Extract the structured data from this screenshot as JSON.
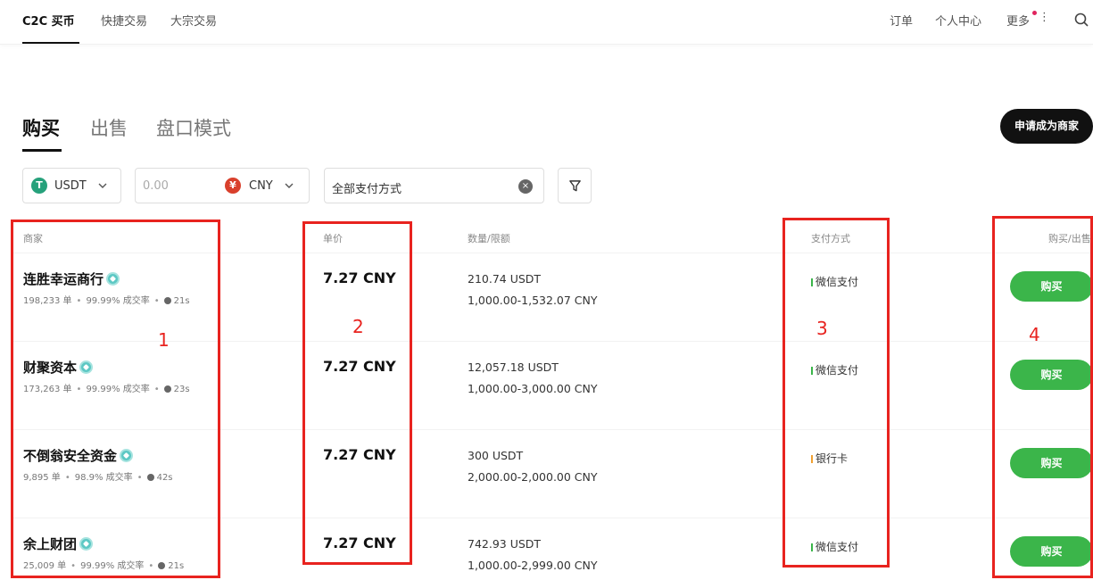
{
  "nav": {
    "items": [
      "C2C 买币",
      "快捷交易",
      "大宗交易"
    ],
    "right": [
      "订单",
      "个人中心",
      "更多"
    ]
  },
  "tabs": [
    "购买",
    "出售",
    "盘口模式"
  ],
  "apply_merchant_label": "申请成为商家",
  "filters": {
    "coin": "USDT",
    "coin_icon": "T",
    "amount_placeholder": "0.00",
    "fiat": "CNY",
    "fiat_icon": "¥",
    "payment": "全部支付方式"
  },
  "columns": {
    "merchant": "商家",
    "price": "单价",
    "quantity": "数量/限额",
    "payment": "支付方式",
    "action": "购买/出售"
  },
  "rows": [
    {
      "name": "连胜幸运商行",
      "orders": "198,233 单",
      "rate": "99.99% 成交率",
      "time": "21s",
      "price": "7.27 CNY",
      "qty": "210.74 USDT",
      "limit": "1,000.00-1,532.07 CNY",
      "payment": "微信支付",
      "pay_color": "#3bb54a",
      "action": "购买"
    },
    {
      "name": "财聚资本",
      "orders": "173,263 单",
      "rate": "99.99% 成交率",
      "time": "23s",
      "price": "7.27 CNY",
      "qty": "12,057.18 USDT",
      "limit": "1,000.00-3,000.00 CNY",
      "payment": "微信支付",
      "pay_color": "#3bb54a",
      "action": "购买"
    },
    {
      "name": "不倒翁安全资金",
      "orders": "9,895 单",
      "rate": "98.9% 成交率",
      "time": "42s",
      "price": "7.27 CNY",
      "qty": "300 USDT",
      "limit": "2,000.00-2,000.00 CNY",
      "payment": "银行卡",
      "pay_color": "#f0a030",
      "action": "购买"
    },
    {
      "name": "余上财团",
      "orders": "25,009 单",
      "rate": "99.99% 成交率",
      "time": "21s",
      "price": "7.27 CNY",
      "qty": "742.93 USDT",
      "limit": "1,000.00-2,999.00 CNY",
      "payment": "微信支付",
      "pay_color": "#3bb54a",
      "action": "购买"
    }
  ],
  "annotations": [
    "1",
    "2",
    "3",
    "4"
  ],
  "colors": {
    "accent_buy": "#3bb54a",
    "annotation": "#e8231f",
    "dark": "#111111"
  }
}
